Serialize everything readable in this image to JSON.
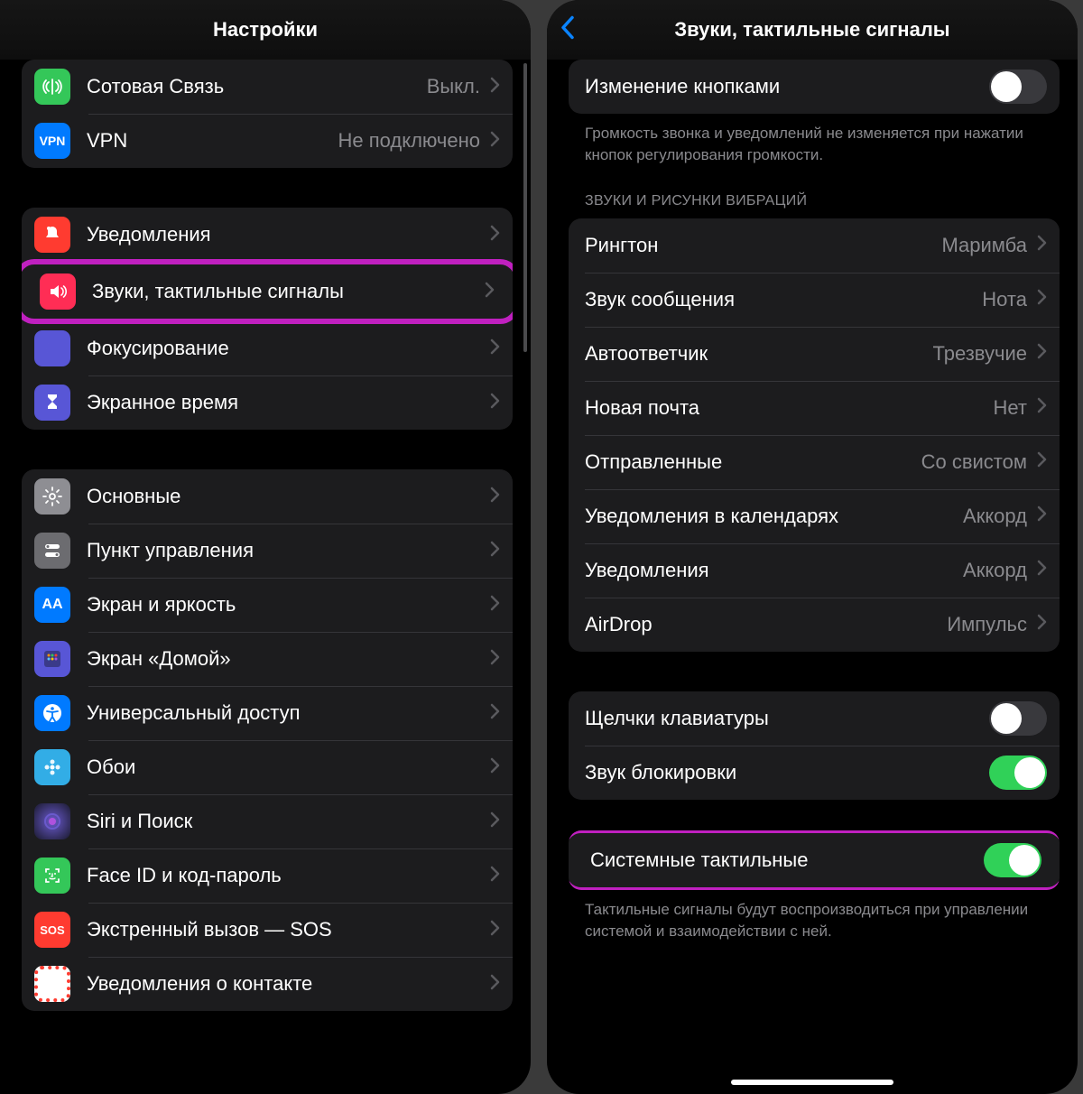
{
  "left": {
    "title": "Настройки",
    "group1": [
      {
        "icon": "antenna",
        "bg": "bg-green",
        "label": "Сотовая Связь",
        "value": "Выкл."
      },
      {
        "icon": "vpn",
        "bg": "bg-blue",
        "label": "VPN",
        "value": "Не подключено"
      }
    ],
    "group2": [
      {
        "icon": "bell",
        "bg": "bg-red",
        "label": "Уведомления"
      },
      {
        "icon": "speaker",
        "bg": "bg-pink",
        "label": "Звуки, тактильные сигналы",
        "highlight": true
      },
      {
        "icon": "moon",
        "bg": "bg-indigo",
        "label": "Фокусирование"
      },
      {
        "icon": "hourglass",
        "bg": "bg-indigo",
        "label": "Экранное время"
      }
    ],
    "group3": [
      {
        "icon": "gear",
        "bg": "bg-gray",
        "label": "Основные"
      },
      {
        "icon": "switches",
        "bg": "bg-gray2",
        "label": "Пункт управления"
      },
      {
        "icon": "aa",
        "bg": "bg-blue",
        "label": "Экран и яркость"
      },
      {
        "icon": "grid",
        "bg": "bg-indigo",
        "label": "Экран «Домой»"
      },
      {
        "icon": "accessibility",
        "bg": "bg-blue",
        "label": "Универсальный доступ"
      },
      {
        "icon": "flower",
        "bg": "bg-cyan",
        "label": "Обои"
      },
      {
        "icon": "siri",
        "bg": "bg-siri",
        "label": "Siri и Поиск"
      },
      {
        "icon": "faceid",
        "bg": "bg-faceid",
        "label": "Face ID и код-пароль"
      },
      {
        "icon": "sos",
        "bg": "bg-sos",
        "label": "Экстренный вызов — SOS"
      },
      {
        "icon": "contact",
        "bg": "bg-contact",
        "label": "Уведомления о контакте"
      }
    ]
  },
  "right": {
    "title": "Звуки, тактильные сигналы",
    "buttons_row": {
      "label": "Изменение кнопками",
      "on": false
    },
    "buttons_footer": "Громкость звонка и уведомлений не изменяется при нажатии кнопок регулирования громкости.",
    "sounds_header": "ЗВУКИ И РИСУНКИ ВИБРАЦИЙ",
    "sounds": [
      {
        "label": "Рингтон",
        "value": "Маримба"
      },
      {
        "label": "Звук сообщения",
        "value": "Нота"
      },
      {
        "label": "Автоответчик",
        "value": "Трезвучие"
      },
      {
        "label": "Новая почта",
        "value": "Нет"
      },
      {
        "label": "Отправленные",
        "value": "Со свистом"
      },
      {
        "label": "Уведомления в календарях",
        "value": "Аккорд"
      },
      {
        "label": "Уведомления",
        "value": "Аккорд"
      },
      {
        "label": "AirDrop",
        "value": "Импульс"
      }
    ],
    "system": [
      {
        "label": "Щелчки клавиатуры",
        "on": false
      },
      {
        "label": "Звук блокировки",
        "on": true
      }
    ],
    "haptics": {
      "label": "Системные тактильные",
      "on": true
    },
    "haptics_footer": "Тактильные сигналы будут воспроизводиться при управлении системой и взаимодействии с ней."
  }
}
